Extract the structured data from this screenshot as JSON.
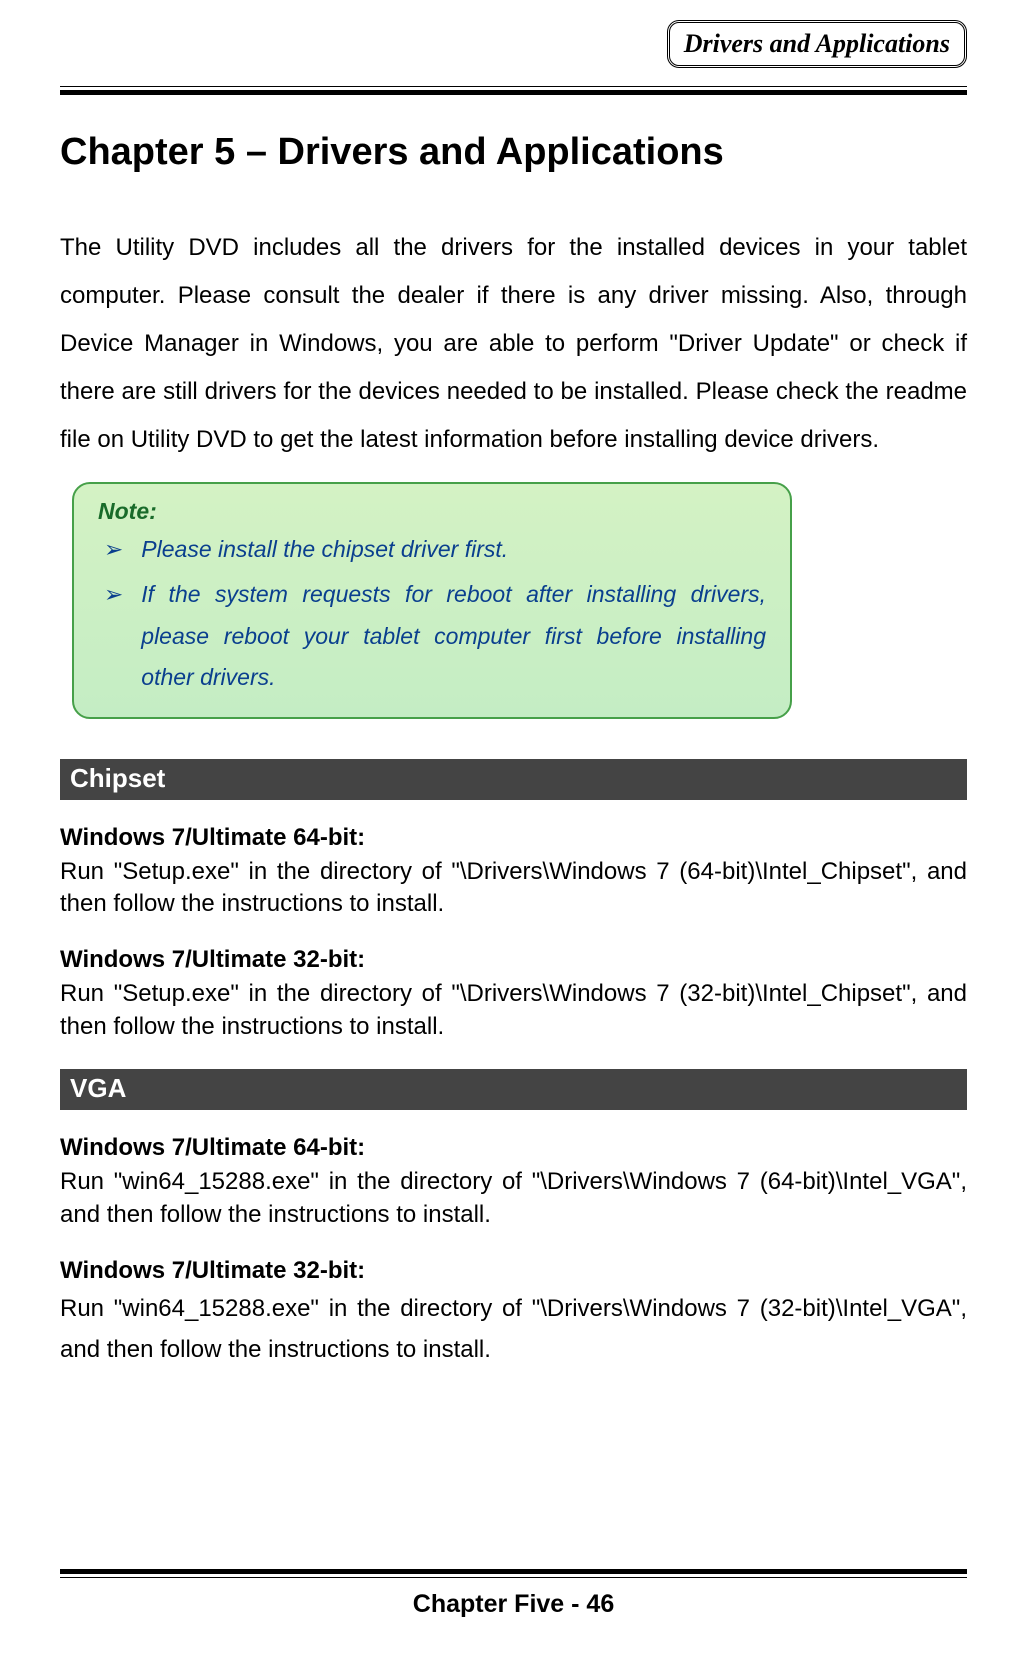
{
  "header": {
    "tab": "Drivers and Applications"
  },
  "chapter": {
    "title": "Chapter 5 – Drivers and Applications"
  },
  "intro": "The Utility DVD includes all the drivers for the installed devices in your tablet computer. Please consult the dealer if there is any driver missing. Also, through Device Manager in Windows, you are able to perform \"Driver Update\" or check if there are still drivers for the devices needed to be installed. Please check the readme file on Utility DVD to get the latest information before installing device drivers.",
  "note": {
    "label": "Note:",
    "bullet": "➢",
    "items": [
      "Please install the chipset driver first.",
      "If the system requests for reboot after installing drivers, please reboot your tablet computer first before installing other drivers."
    ]
  },
  "sections": [
    {
      "title": "Chipset",
      "blocks": [
        {
          "subhead": "Windows 7/Ultimate 64-bit:",
          "text": "Run \"Setup.exe\" in the directory of \"\\Drivers\\Windows 7 (64-bit)\\Intel_Chipset\", and then follow the instructions to install."
        },
        {
          "subhead": "Windows 7/Ultimate 32-bit:",
          "text": "Run \"Setup.exe\" in the directory of \"\\Drivers\\Windows 7 (32-bit)\\Intel_Chipset\", and then follow the instructions to install."
        }
      ]
    },
    {
      "title": "VGA",
      "blocks": [
        {
          "subhead": "Windows 7/Ultimate 64-bit:",
          "text": "Run \"win64_15288.exe\" in the directory of \"\\Drivers\\Windows 7 (64-bit)\\Intel_VGA\", and then follow the instructions to install."
        },
        {
          "subhead": "Windows 7/Ultimate 32-bit:",
          "text": "Run \"win64_15288.exe\" in the directory of \"\\Drivers\\Windows 7 (32-bit)\\Intel_VGA\", and then follow the instructions to install."
        }
      ]
    }
  ],
  "footer": {
    "text": "Chapter Five - 46"
  }
}
